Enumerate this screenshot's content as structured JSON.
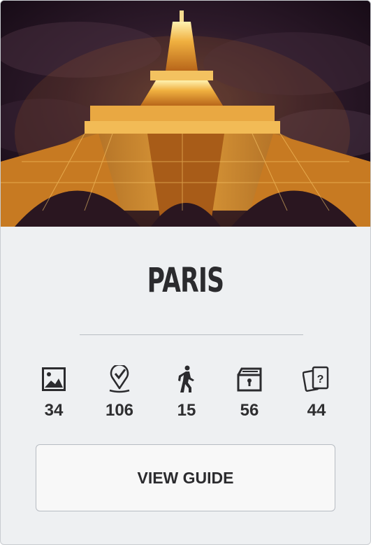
{
  "city": {
    "name": "PARIS"
  },
  "hero": {
    "subject": "Eiffel Tower at night"
  },
  "stats": [
    {
      "icon": "photo-icon",
      "value": "34"
    },
    {
      "icon": "map-pin-check-icon",
      "value": "106"
    },
    {
      "icon": "walking-person-icon",
      "value": "15"
    },
    {
      "icon": "locked-chest-icon",
      "value": "56"
    },
    {
      "icon": "question-cards-icon",
      "value": "44"
    }
  ],
  "actions": {
    "view_guide_label": "VIEW GUIDE"
  },
  "colors": {
    "card_bg": "#eef0f2",
    "text": "#2b2b2e",
    "tower_glow": "#e8a030",
    "sky": "#1c0f1c"
  }
}
